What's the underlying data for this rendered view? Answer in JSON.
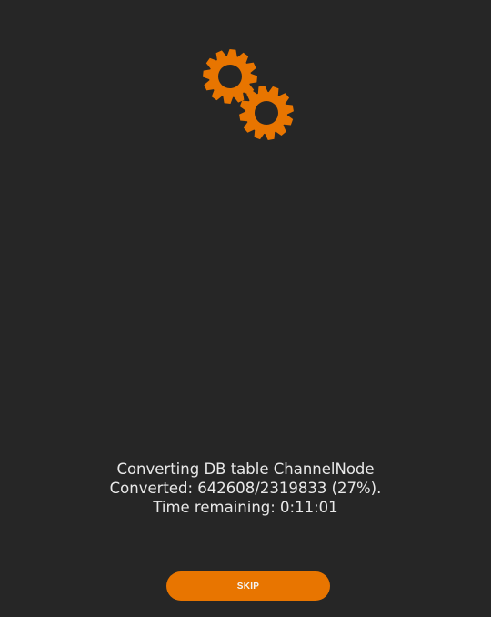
{
  "colors": {
    "background": "#262626",
    "accent": "#e87500",
    "text": "#e8e8e8"
  },
  "icon": "gears-icon",
  "status": {
    "line1": "Converting DB table ChannelNode",
    "line2": "Converted: 642608/2319833 (27%).",
    "line3": "Time remaining: 0:11:01"
  },
  "progress": {
    "converted": 642608,
    "total": 2319833,
    "percent": 27,
    "time_remaining": "0:11:01"
  },
  "skip_label": "SKIP"
}
